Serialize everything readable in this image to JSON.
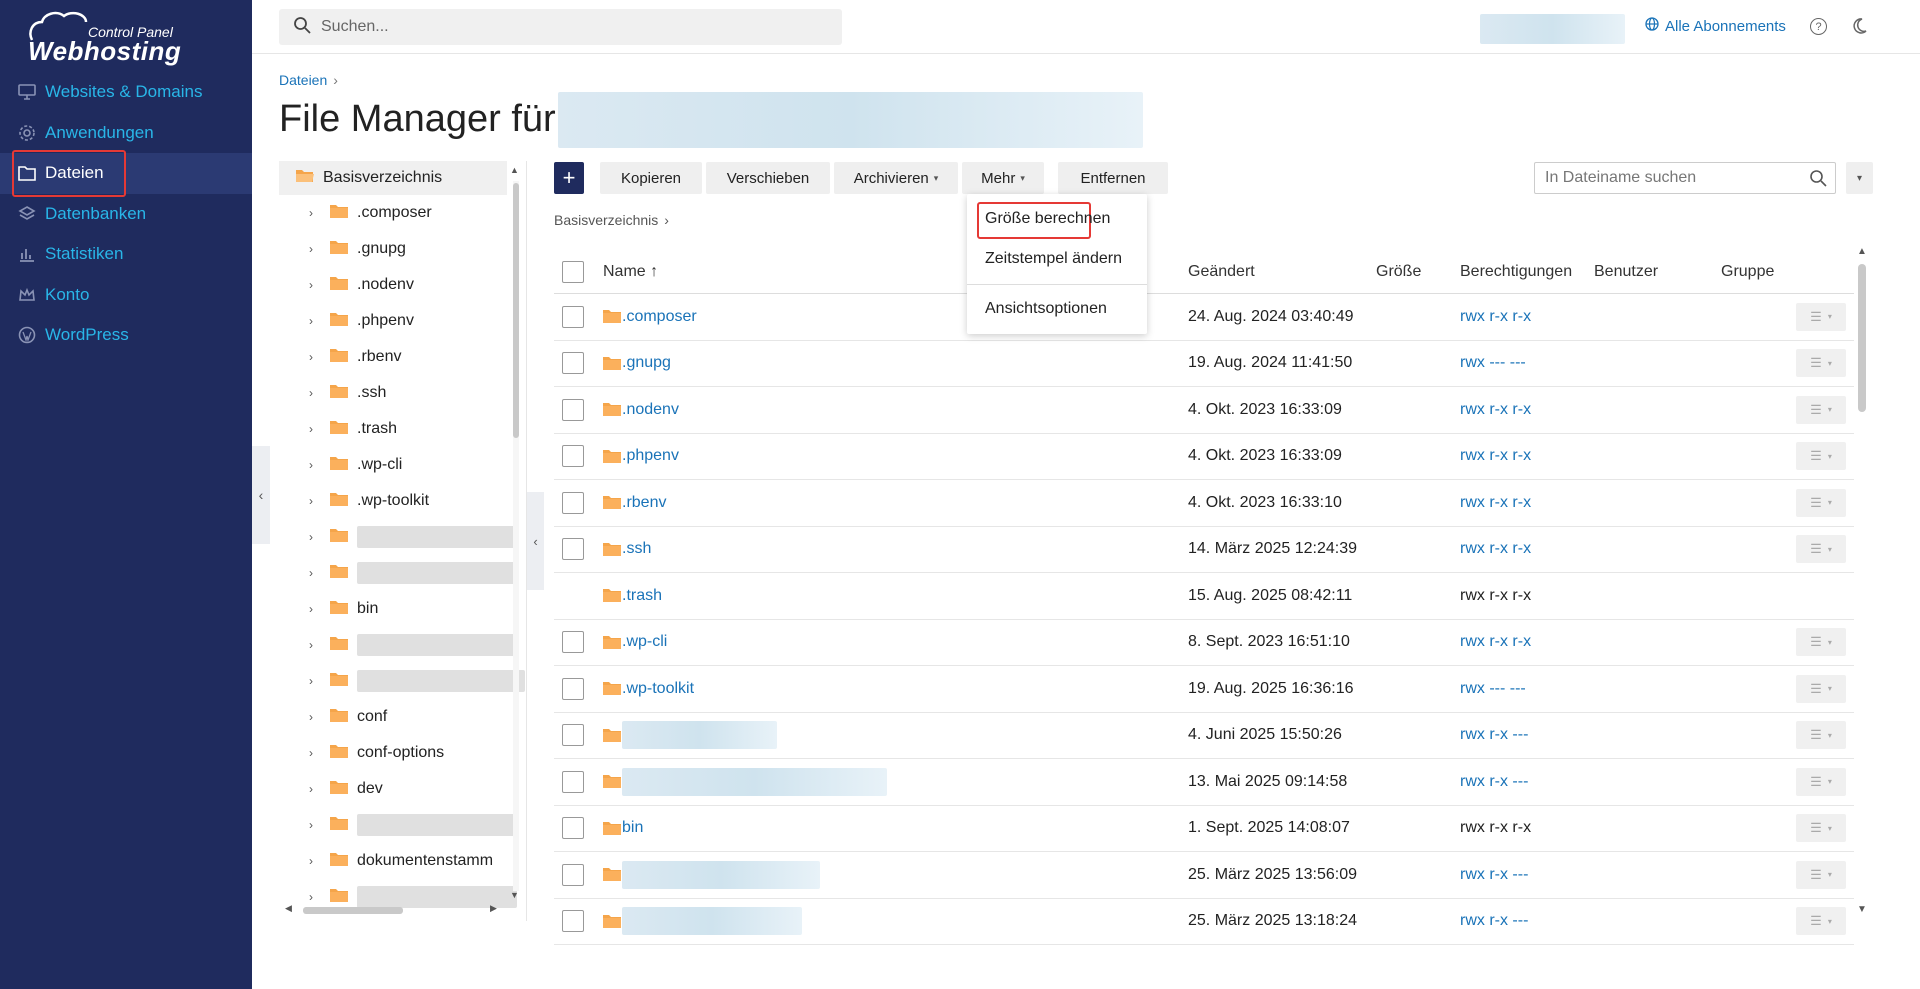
{
  "sidebar": {
    "logo_small": "Control Panel",
    "logo_main": "Webhosting",
    "items": [
      {
        "label": "Websites & Domains",
        "icon": "monitor-icon"
      },
      {
        "label": "Anwendungen",
        "icon": "gear-icon"
      },
      {
        "label": "Dateien",
        "icon": "folder-icon",
        "active": true
      },
      {
        "label": "Datenbanken",
        "icon": "database-icon"
      },
      {
        "label": "Statistiken",
        "icon": "bar-chart-icon"
      },
      {
        "label": "Konto",
        "icon": "crown-icon"
      },
      {
        "label": "WordPress",
        "icon": "wordpress-icon"
      }
    ]
  },
  "topbar": {
    "search_placeholder": "Suchen...",
    "subscriptions_label": "Alle Abonnements",
    "help_label": "?"
  },
  "page": {
    "breadcrumb": "Dateien",
    "title": "File Manager für"
  },
  "tree": {
    "root": "Basisverzeichnis",
    "items": [
      ".composer",
      ".gnupg",
      ".nodenv",
      ".phpenv",
      ".rbenv",
      ".ssh",
      ".trash",
      ".wp-cli",
      ".wp-toolkit",
      "",
      "",
      "bin",
      "",
      "",
      "conf",
      "conf-options",
      "dev",
      "",
      "dokumentenstamm",
      ""
    ]
  },
  "toolbar": {
    "plus_label": "+",
    "copy_label": "Kopieren",
    "move_label": "Verschieben",
    "archive_label": "Archivieren",
    "more_label": "Mehr",
    "remove_label": "Entfernen",
    "filename_search_placeholder": "In Dateiname suchen"
  },
  "files_breadcrumb": "Basisverzeichnis",
  "table": {
    "columns": {
      "name": "Name ↑",
      "modified": "Geändert",
      "size": "Größe",
      "permissions": "Berechtigungen",
      "user": "Benutzer",
      "group": "Gruppe"
    },
    "rows": [
      {
        "name": ".composer",
        "modified": "24. Aug. 2024 03:40:49",
        "perm": "rwx r-x r-x",
        "link": true,
        "checkbox": true
      },
      {
        "name": ".gnupg",
        "modified": "19. Aug. 2024 11:41:50",
        "perm": "rwx --- ---",
        "link": true,
        "checkbox": true
      },
      {
        "name": ".nodenv",
        "modified": "4. Okt. 2023 16:33:09",
        "perm": "rwx r-x r-x",
        "link": true,
        "checkbox": true
      },
      {
        "name": ".phpenv",
        "modified": "4. Okt. 2023 16:33:09",
        "perm": "rwx r-x r-x",
        "link": true,
        "checkbox": true
      },
      {
        "name": ".rbenv",
        "modified": "4. Okt. 2023 16:33:10",
        "perm": "rwx r-x r-x",
        "link": true,
        "checkbox": true
      },
      {
        "name": ".ssh",
        "modified": "14. März 2025 12:24:39",
        "perm": "rwx r-x r-x",
        "link": true,
        "checkbox": true
      },
      {
        "name": ".trash",
        "modified": "15. Aug. 2025 08:42:11",
        "perm": "rwx r-x r-x",
        "link": false,
        "checkbox": false
      },
      {
        "name": ".wp-cli",
        "modified": "8. Sept. 2023 16:51:10",
        "perm": "rwx r-x r-x",
        "link": true,
        "checkbox": true
      },
      {
        "name": ".wp-toolkit",
        "modified": "19. Aug. 2025 16:36:16",
        "perm": "rwx --- ---",
        "link": true,
        "checkbox": true
      },
      {
        "name": "",
        "modified": "4. Juni 2025 15:50:26",
        "perm": "rwx r-x ---",
        "link": true,
        "checkbox": true
      },
      {
        "name": "",
        "modified": "13. Mai 2025 09:14:58",
        "perm": "rwx r-x ---",
        "link": true,
        "checkbox": true
      },
      {
        "name": "bin",
        "modified": "1. Sept. 2025 14:08:07",
        "perm": "rwx r-x r-x",
        "link": false,
        "checkbox": true
      },
      {
        "name": "",
        "modified": "25. März 2025 13:56:09",
        "perm": "rwx r-x ---",
        "link": true,
        "checkbox": true
      },
      {
        "name": "",
        "modified": "25. März 2025 13:18:24",
        "perm": "rwx r-x ---",
        "link": true,
        "checkbox": true
      }
    ]
  },
  "more_menu": {
    "calc_size": "Größe berechnen",
    "change_timestamp": "Zeitstempel ändern",
    "view_options": "Ansichtsoptionen"
  },
  "colors": {
    "sidebar_bg": "#1f2b5e",
    "accent": "#29b6e8",
    "link": "#1a73b8",
    "folder": "#f5a54a",
    "highlight": "#e53935"
  }
}
